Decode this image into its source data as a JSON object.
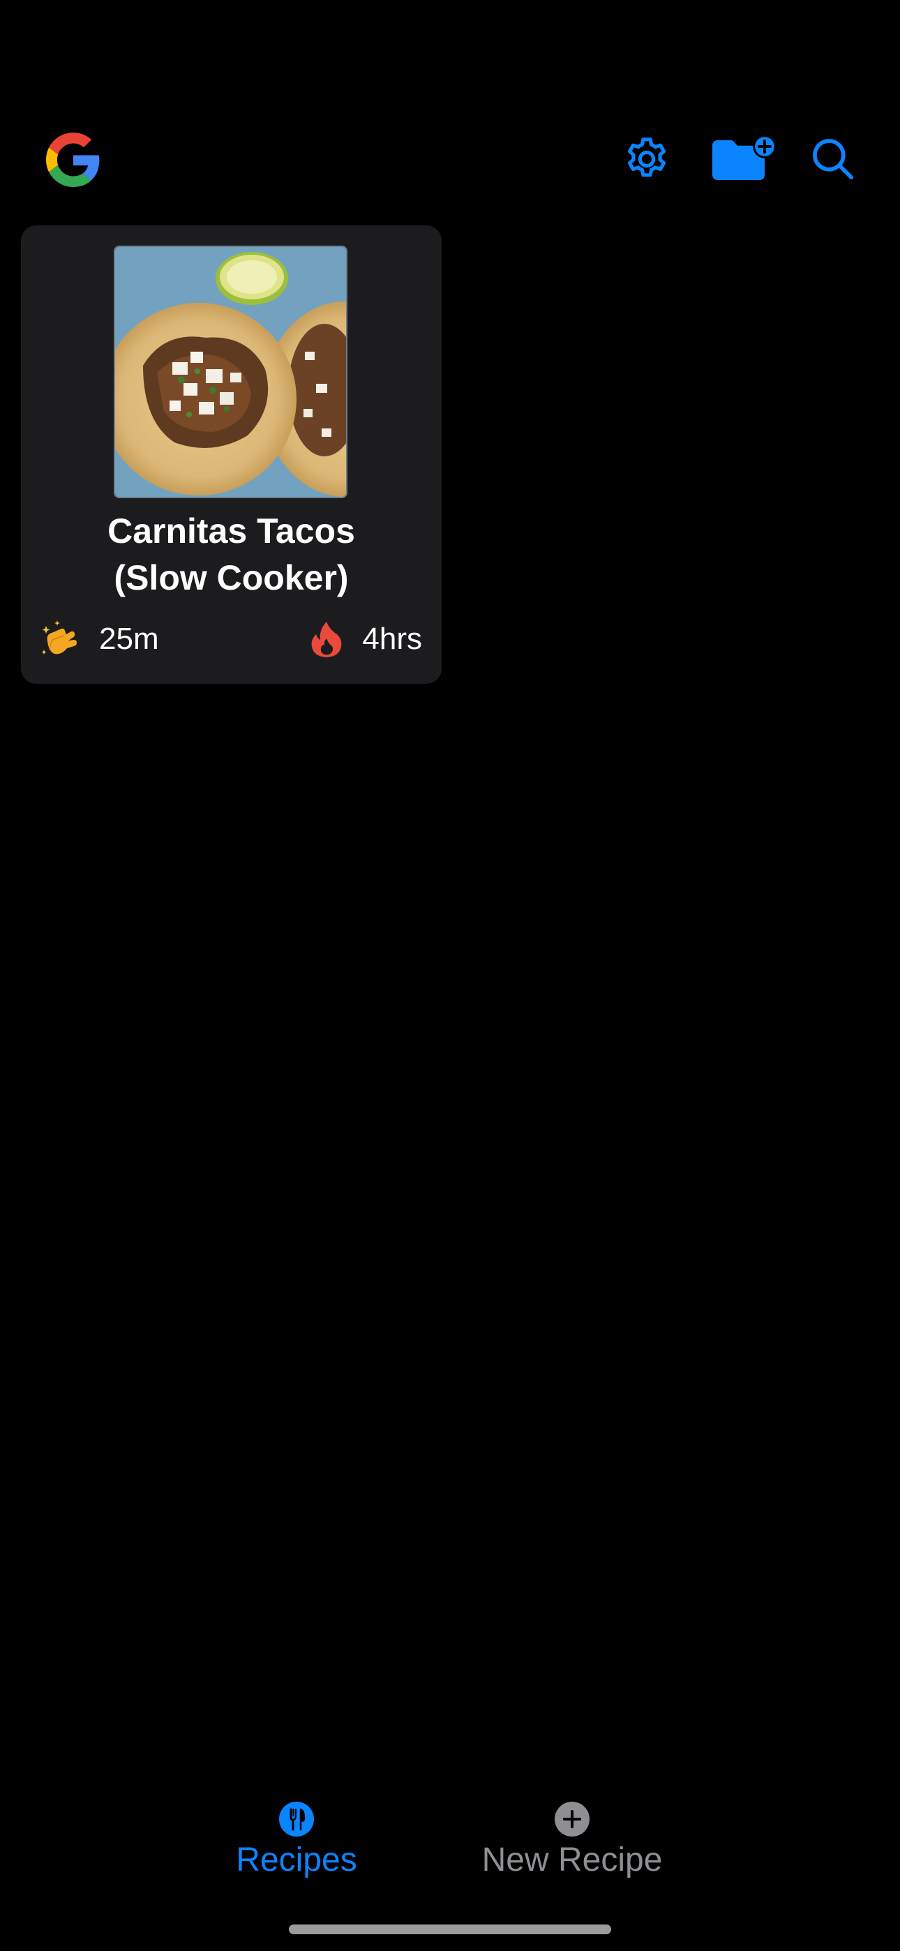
{
  "colors": {
    "background": "#000000",
    "card": "#1c1c1e",
    "accent": "#0a84ff",
    "inactive": "#8e8e93"
  },
  "header": {
    "logo": "google-logo",
    "actions": [
      {
        "icon": "gear-icon"
      },
      {
        "icon": "folder-plus-icon"
      },
      {
        "icon": "search-icon"
      }
    ]
  },
  "recipes": [
    {
      "title_line1": "Carnitas Tacos",
      "title_line2": "(Slow Cooker)",
      "prep_icon": "clapping-hands-emoji",
      "prep_time": "25m",
      "cook_icon": "fire-emoji",
      "cook_time": "4hrs"
    }
  ],
  "tabbar": {
    "tabs": [
      {
        "label": "Recipes",
        "icon": "fork-knife-icon",
        "selected": true
      },
      {
        "label": "New Recipe",
        "icon": "plus-circle-icon",
        "selected": false
      }
    ]
  }
}
